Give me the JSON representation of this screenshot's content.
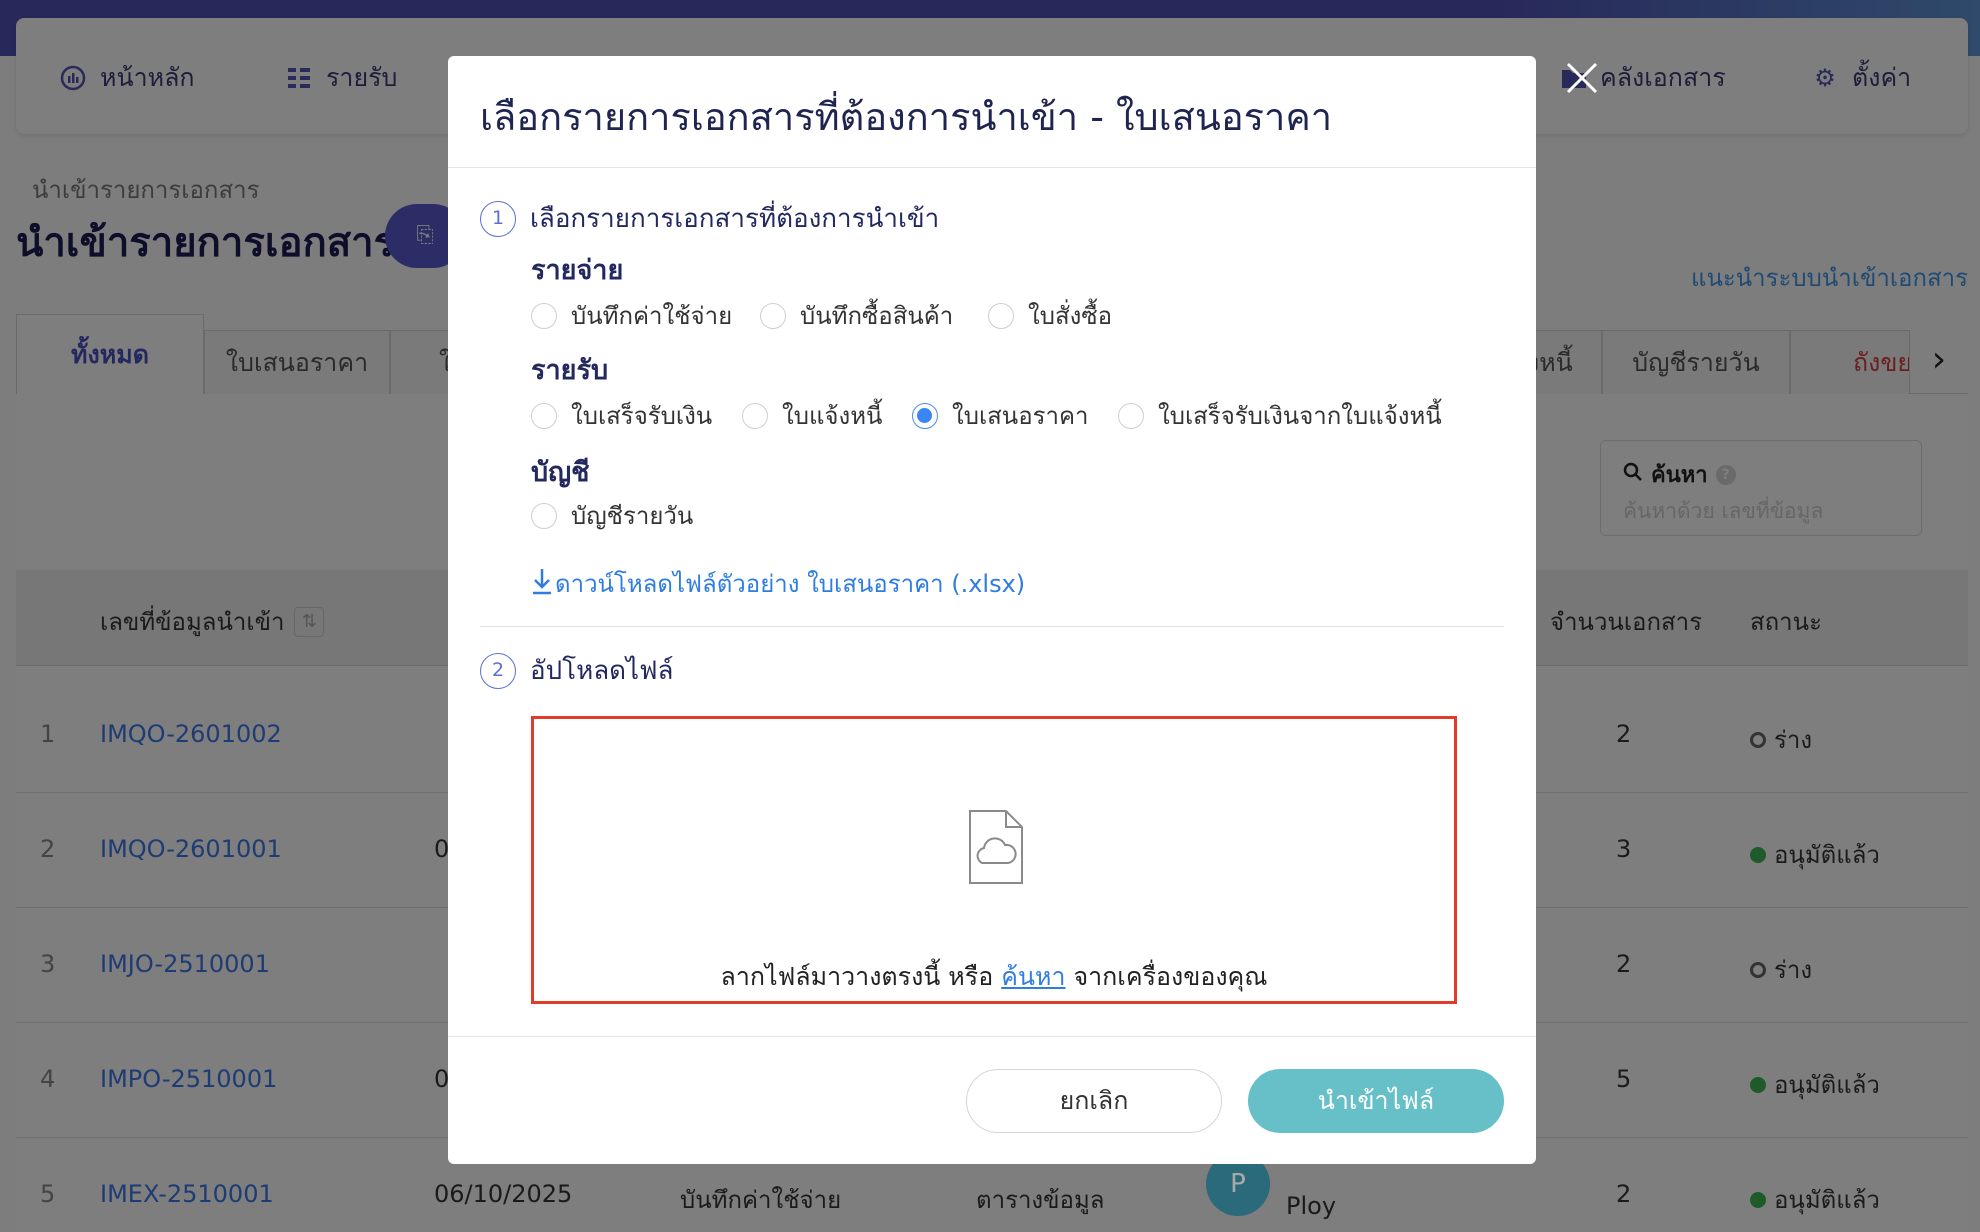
{
  "nav": {
    "items": [
      {
        "label": "หน้าหลัก",
        "icon": "chart-icon"
      },
      {
        "label": "รายรับ",
        "icon": "list-icon"
      },
      {
        "label": "คลังเอกสาร",
        "icon": "folder-icon"
      },
      {
        "label": "ตั้งค่า",
        "icon": "gear-icon"
      }
    ]
  },
  "breadcrumb": "นำเข้ารายการเอกสาร",
  "page_title": "นำเข้ารายการเอกสาร",
  "help_link": "แนะนำระบบนำเข้าเอกสาร",
  "tabs": [
    {
      "label": "ทั้งหมด"
    },
    {
      "label": "ใบเสนอราคา"
    },
    {
      "label": "ใ"
    },
    {
      "label": "งหนี้"
    },
    {
      "label": "บัญชีรายวัน"
    },
    {
      "label": "ถังขยะ"
    }
  ],
  "search": {
    "label": "ค้นหา",
    "placeholder": "ค้นหาด้วย เลขที่ข้อมูล"
  },
  "table": {
    "headers": {
      "doc_no": "เลขที่ข้อมูลนำเข้า",
      "count": "จำนวนเอกสาร",
      "status": "สถานะ"
    },
    "rows": [
      {
        "idx": "1",
        "doc": "IMQO-2601002",
        "date": "",
        "type": "",
        "source": "",
        "user": "",
        "count": "2",
        "status": "ร่าง",
        "status_kind": "draft"
      },
      {
        "idx": "2",
        "doc": "IMQO-2601001",
        "date": "0",
        "type": "",
        "source": "",
        "user": "",
        "count": "3",
        "status": "อนุมัติแล้ว",
        "status_kind": "ok"
      },
      {
        "idx": "3",
        "doc": "IMJO-2510001",
        "date": "",
        "type": "",
        "source": "",
        "user": "",
        "count": "2",
        "status": "ร่าง",
        "status_kind": "draft"
      },
      {
        "idx": "4",
        "doc": "IMPO-2510001",
        "date": "0",
        "type": "",
        "source": "",
        "user": "",
        "count": "5",
        "status": "อนุมัติแล้ว",
        "status_kind": "ok"
      },
      {
        "idx": "5",
        "doc": "IMEX-2510001",
        "date": "06/10/2025",
        "type": "บันทึกค่าใช้จ่าย",
        "source": "ตารางข้อมูล",
        "user": "Ploy",
        "user_initial": "P",
        "count": "2",
        "status": "อนุมัติแล้ว",
        "status_kind": "ok"
      }
    ]
  },
  "modal": {
    "title": "เลือกรายการเอกสารที่ต้องการนำเข้า - ใบเสนอราคา",
    "step1": {
      "num": "1",
      "title": "เลือกรายการเอกสารที่ต้องการนำเข้า"
    },
    "groups": {
      "expense": {
        "label": "รายจ่าย",
        "options": [
          "บันทึกค่าใช้จ่าย",
          "บันทึกซื้อสินค้า",
          "ใบสั่งซื้อ"
        ]
      },
      "income": {
        "label": "รายรับ",
        "options": [
          "ใบเสร็จรับเงิน",
          "ใบแจ้งหนี้",
          "ใบเสนอราคา",
          "ใบเสร็จรับเงินจากใบแจ้งหนี้"
        ],
        "selected": "ใบเสนอราคา"
      },
      "account": {
        "label": "บัญชี",
        "options": [
          "บัญชีรายวัน"
        ]
      }
    },
    "download_link": "ดาวน์โหลดไฟล์ตัวอย่าง ใบเสนอราคา (.xlsx)",
    "step2": {
      "num": "2",
      "title": "อัปโหลดไฟล์"
    },
    "dropzone": {
      "text_before": "ลากไฟล์มาวางตรงนี้ หรือ",
      "link": "ค้นหา",
      "text_after": "จากเครื่องของคุณ"
    },
    "cancel_label": "ยกเลิก",
    "import_label": "นำเข้าไฟล์"
  },
  "colors": {
    "accent": "#3b86f5",
    "primary_button": "#67c0c8",
    "dropzone_border": "#e23b2a",
    "title": "#1f2450"
  }
}
